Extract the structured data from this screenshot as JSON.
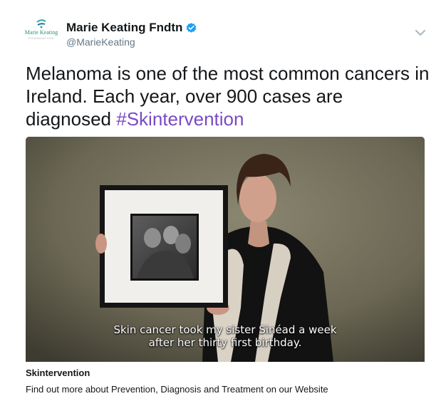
{
  "author": {
    "display_name": "Marie Keating Fndtn",
    "handle": "@MarieKeating",
    "verified": true,
    "logo_text": "Marie Keating",
    "logo_sub": "FOUNDATION",
    "verified_icon": "verified-badge-icon",
    "menu_icon": "chevron-down-icon"
  },
  "tweet": {
    "text": "Melanoma is one of the most common cancers in Ireland. Each year, over 900 cases are diagnosed ",
    "hashtag": "#Skintervention"
  },
  "media": {
    "subtitle_line1": "Skin cancer took my sister Sinéad a week",
    "subtitle_line2": "after her thirty first birthday."
  },
  "card": {
    "title": "Skintervention",
    "description": "Find out more about Prevention, Diagnosis and Treatment on our Website"
  },
  "colors": {
    "hashtag": "#794bc4",
    "verified": "#1da1f2",
    "handle": "#657786",
    "text": "#14171a"
  }
}
